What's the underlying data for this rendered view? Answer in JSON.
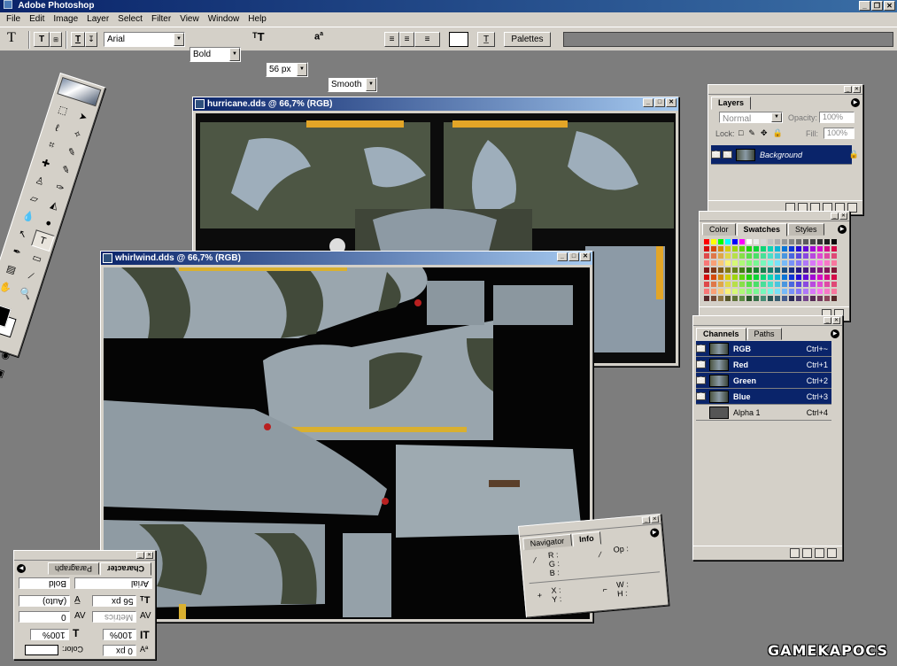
{
  "app": {
    "title": "Adobe Photoshop",
    "window_buttons": [
      "_",
      "❐",
      "✕"
    ]
  },
  "menu": [
    "File",
    "Edit",
    "Image",
    "Layer",
    "Select",
    "Filter",
    "View",
    "Window",
    "Help"
  ],
  "options_bar": {
    "tool_icon": "T",
    "font_family": "Arial",
    "font_style": "Bold",
    "font_size": "56 px",
    "aa_label": "a",
    "antialias": "Smooth",
    "palettes_button": "Palettes",
    "text_orient_icons": [
      "T",
      "T"
    ],
    "colors": {
      "text_color": "#ffffff"
    }
  },
  "documents": [
    {
      "title": "hurricane.dds @ 66,7% (RGB)"
    },
    {
      "title": "whirlwind.dds @ 66,7% (RGB)"
    }
  ],
  "layers_palette": {
    "tab": "Layers",
    "blend_mode": "Normal",
    "opacity_label": "Opacity:",
    "opacity_value": "100%",
    "lock_label": "Lock:",
    "fill_label": "Fill:",
    "fill_value": "100%",
    "layer_name": "Background"
  },
  "swatches_palette": {
    "tabs": [
      "Color",
      "Swatches",
      "Styles"
    ]
  },
  "channels_palette": {
    "tabs": [
      "Channels",
      "Paths"
    ],
    "channels": [
      {
        "name": "RGB",
        "shortcut": "Ctrl+~"
      },
      {
        "name": "Red",
        "shortcut": "Ctrl+1"
      },
      {
        "name": "Green",
        "shortcut": "Ctrl+2"
      },
      {
        "name": "Blue",
        "shortcut": "Ctrl+3"
      },
      {
        "name": "Alpha 1",
        "shortcut": "Ctrl+4"
      }
    ]
  },
  "navigator_palette": {
    "tabs": [
      "Navigator",
      "Info"
    ],
    "labels": {
      "r": "R :",
      "g": "G :",
      "b": "B :",
      "op": "Op :",
      "x": "X :",
      "y": "Y :",
      "w": "W :",
      "h": "H :"
    }
  },
  "character_palette": {
    "tabs": [
      "Character",
      "Paragraph"
    ],
    "font": "Arial",
    "style": "Bold",
    "size": "56 px",
    "leading": "(Auto)",
    "kerning": "Metrics",
    "tracking": "0",
    "vscale": "100%",
    "hscale": "100%",
    "baseline": "0 px",
    "color_label": "Color:"
  },
  "watermark": "GAMEKAPOCS"
}
